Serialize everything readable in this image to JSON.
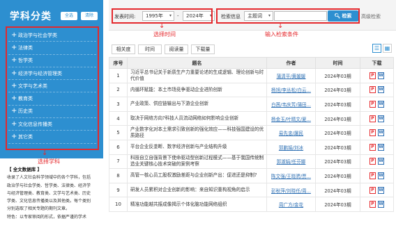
{
  "sidebar": {
    "title": "学科分类",
    "all_label": "全选",
    "clear_label": "清除",
    "items": [
      {
        "label": "政治学与社会学类"
      },
      {
        "label": "法律类"
      },
      {
        "label": "哲学类"
      },
      {
        "label": "经济学与经济管理类"
      },
      {
        "label": "文学与艺术类"
      },
      {
        "label": "教育类"
      },
      {
        "label": "历史类"
      },
      {
        "label": "文化信息传播类"
      },
      {
        "label": "其它类"
      }
    ],
    "annotation": "选择学科",
    "description": {
      "title": "【 全文数据库 】",
      "lines": [
        "收录了人文社会科学领域中的各个学科，包括",
        "政治学与社会学类、哲学类、法律类、经济学",
        "与经济管理类、教育类、文学与艺术类、历史",
        "学类、文化信息传播类以及其他类。每个类别",
        "分别选取了相关专题的期刊文章。",
        "特色：以专家审阅的形式，依据严谨的学术"
      ]
    }
  },
  "filter": {
    "time_label": "发表时间:",
    "from_year": "1995年",
    "to_label": "-",
    "to_year": "2024年",
    "time_annotation": "选择时间",
    "field_label": "检索信息",
    "field_select": "主题词",
    "search_value": "",
    "search_label": "检索",
    "advanced_label": "高级检索",
    "search_annotation": "输入检索条件"
  },
  "toolbar": {
    "buttons": [
      "相关度",
      "时间",
      "阅读量",
      "下载量"
    ],
    "list_view_icon": "list-icon",
    "grid_view_icon": "grid-icon"
  },
  "table": {
    "headers": [
      "序号",
      "题名",
      "作者",
      "时间",
      "下载"
    ],
    "rows": [
      {
        "num": "1",
        "title": "习近平总书记关于新质生产力重要论述的生成逻辑、理论创新与时代价值",
        "author": "蒲清平/黄媛媛",
        "time": "2024年03期"
      },
      {
        "num": "2",
        "title": "内循环赋能：本土市场竞争驱动企业进阶创新",
        "author": "杨旭/李丛松/白云...",
        "time": "2024年03期"
      },
      {
        "num": "3",
        "title": "产业政策、供应链输出与下游企业创新",
        "author": "白茜/韦庆芳/蒲田...",
        "time": "2024年03期"
      },
      {
        "num": "4",
        "title": "取决于网络方向?科技人员流动网络如何影响企业创新",
        "author": "杨金玉/叶晴文/夏...",
        "time": "2024年03期"
      },
      {
        "num": "5",
        "title": "产业数字化对本土需求引致创新的强化效应——科技强国建设的优质路径",
        "author": "易先忠/屠民",
        "time": "2024年03期"
      },
      {
        "num": "6",
        "title": "平台企业反垄断、数字经济创新与产业结构升级",
        "author": "郭鹏娟/刘冰",
        "time": "2024年03期"
      },
      {
        "num": "7",
        "title": "科技自立自强背景下使命驱动型创新过程模式——基于我国传统制造业关键核心技术突破的案例考察",
        "author": "郭淑娟/任芬娜",
        "time": "2024年03期"
      },
      {
        "num": "8",
        "title": "高管一核心员工股权激励差距与企业创新产出：促进还是抑制?",
        "author": "陈文强/王晓骋/贾...",
        "time": "2024年03期"
      },
      {
        "num": "9",
        "title": "研发人员累积对企业创新的影响：来自知识重构视角的启示",
        "author": "彭秋萍/刘晓任/周...",
        "time": "2024年03期"
      },
      {
        "num": "10",
        "title": "精准功能越共振成像揭示个体化脑功能网络组织",
        "author": "周广方/金花",
        "time": "2024年03期"
      }
    ],
    "pdf_label": "P",
    "word_label": "W"
  }
}
